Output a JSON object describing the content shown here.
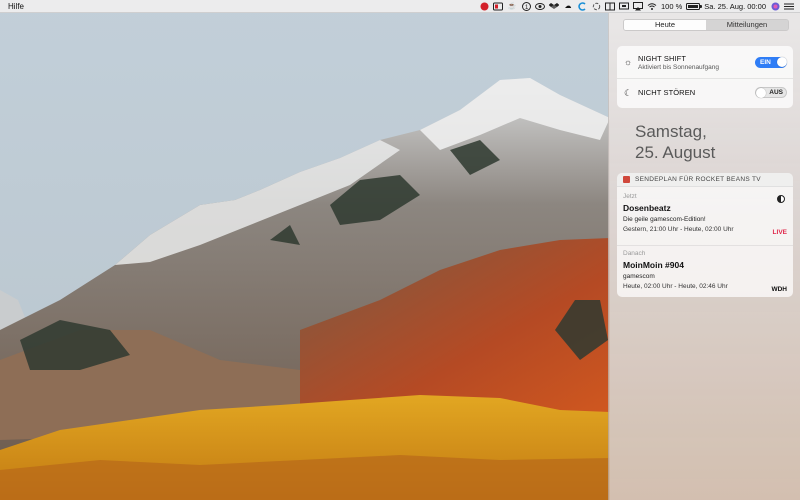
{
  "menubar": {
    "menu_help": "Hilfe",
    "status_icons": [
      "red-record-icon",
      "screen-icon",
      "cup-icon",
      "one-icon",
      "eye-icon",
      "dropbox-icon",
      "cloud-icon",
      "c-icon",
      "sync-icon",
      "split-window-icon",
      "display-icon",
      "airplay-icon",
      "wifi-icon"
    ],
    "battery_percent": "100 %",
    "battery_level": 1.0,
    "datetime": "Sa. 25. Aug.  00:00",
    "siri_icon": "siri-icon",
    "notification_icon": "list-icon"
  },
  "notification_center": {
    "tabs": [
      {
        "label": "Heute",
        "active": true
      },
      {
        "label": "Mitteilungen",
        "active": false
      }
    ],
    "night_shift": {
      "title": "NIGHT SHIFT",
      "subtitle": "Aktiviert bis Sonnenaufgang",
      "state_label": "EIN",
      "on": true,
      "icon": "sun-icon"
    },
    "do_not_disturb": {
      "title": "NICHT STÖREN",
      "state_label": "AUS",
      "on": false,
      "icon": "moon-icon"
    },
    "date_line1": "Samstag,",
    "date_line2": "25. August",
    "widget": {
      "title": "SENDEPLAN FÜR ROCKET BEANS TV",
      "entries": [
        {
          "when": "Jetzt",
          "show": "Dosenbeatz",
          "desc": "Die geile gamescom-Edition!",
          "time": "Gestern, 21:00 Uhr - Heute, 02:00 Uhr",
          "badge": "LIVE"
        },
        {
          "when": "Danach",
          "show": "MoinMoin #904",
          "desc": "gamescom",
          "time": "Heute, 02:00 Uhr - Heute, 02:46 Uhr",
          "badge": "WDH"
        }
      ]
    }
  },
  "colors": {
    "toggle_on": "#2f7df6",
    "live_badge": "#e0284b"
  }
}
